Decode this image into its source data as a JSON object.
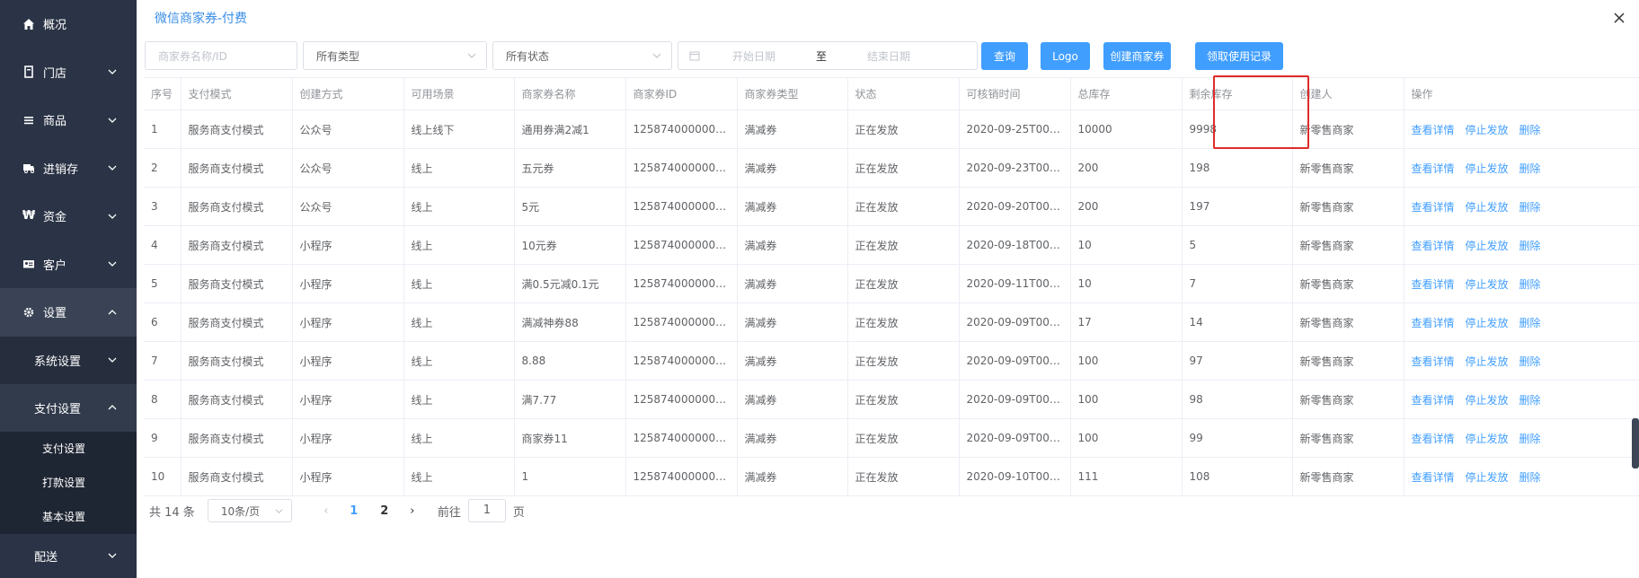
{
  "sidebar": {
    "items": [
      {
        "label": "概况",
        "icon": "home-icon"
      },
      {
        "label": "门店",
        "icon": "store-icon"
      },
      {
        "label": "商品",
        "icon": "list-icon"
      },
      {
        "label": "进销存",
        "icon": "truck-icon"
      },
      {
        "label": "资金",
        "icon": "won-icon"
      },
      {
        "label": "客户",
        "icon": "idcard-icon"
      },
      {
        "label": "设置",
        "icon": "gear-icon"
      }
    ],
    "settings_sub": {
      "system": "系统设置",
      "payment": "支付设置"
    },
    "payment_leaves": [
      "支付设置",
      "打款设置",
      "基本设置"
    ],
    "delivery": "配送"
  },
  "dialog": {
    "title": "微信商家券-付费"
  },
  "filters": {
    "name_placeholder": "商家券名称/ID",
    "type_value": "所有类型",
    "status_value": "所有状态",
    "start_placeholder": "开始日期",
    "range_sep": "至",
    "end_placeholder": "结束日期"
  },
  "buttons": {
    "query": "查询",
    "logo": "Logo",
    "create": "创建商家券",
    "records": "领取使用记录"
  },
  "table": {
    "headers": [
      "序号",
      "支付模式",
      "创建方式",
      "可用场景",
      "商家券名称",
      "商家券ID",
      "商家券类型",
      "状态",
      "可核销时间",
      "总库存",
      "剩余库存",
      "创建人",
      "操作"
    ],
    "actions": [
      "查看详情",
      "停止发放",
      "删除"
    ],
    "rows": [
      [
        "1",
        "服务商支付模式",
        "公众号",
        "线上线下",
        "通用券满2减1",
        "1258740000000...",
        "满减券",
        "正在发放",
        "2020-09-25T00:0...",
        "10000",
        "9998",
        "新零售商家"
      ],
      [
        "2",
        "服务商支付模式",
        "公众号",
        "线上",
        "五元券",
        "1258740000000...",
        "满减券",
        "正在发放",
        "2020-09-23T00:0...",
        "200",
        "198",
        "新零售商家"
      ],
      [
        "3",
        "服务商支付模式",
        "公众号",
        "线上",
        "5元",
        "1258740000000...",
        "满减券",
        "正在发放",
        "2020-09-20T00:0...",
        "200",
        "197",
        "新零售商家"
      ],
      [
        "4",
        "服务商支付模式",
        "小程序",
        "线上",
        "10元券",
        "1258740000000...",
        "满减券",
        "正在发放",
        "2020-09-18T00:0...",
        "10",
        "5",
        "新零售商家"
      ],
      [
        "5",
        "服务商支付模式",
        "小程序",
        "线上",
        "满0.5元减0.1元",
        "1258740000000...",
        "满减券",
        "正在发放",
        "2020-09-11T00:0...",
        "10",
        "7",
        "新零售商家"
      ],
      [
        "6",
        "服务商支付模式",
        "小程序",
        "线上",
        "满减神券88",
        "1258740000000...",
        "满减券",
        "正在发放",
        "2020-09-09T00:0...",
        "17",
        "14",
        "新零售商家"
      ],
      [
        "7",
        "服务商支付模式",
        "小程序",
        "线上",
        "8.88",
        "1258740000000...",
        "满减券",
        "正在发放",
        "2020-09-09T00:0...",
        "100",
        "97",
        "新零售商家"
      ],
      [
        "8",
        "服务商支付模式",
        "小程序",
        "线上",
        "满7.77",
        "1258740000000...",
        "满减券",
        "正在发放",
        "2020-09-09T00:0...",
        "100",
        "98",
        "新零售商家"
      ],
      [
        "9",
        "服务商支付模式",
        "小程序",
        "线上",
        "商家券11",
        "1258740000000...",
        "满减券",
        "正在发放",
        "2020-09-09T00:0...",
        "100",
        "99",
        "新零售商家"
      ],
      [
        "10",
        "服务商支付模式",
        "小程序",
        "线上",
        "1",
        "1258740000000...",
        "满减券",
        "正在发放",
        "2020-09-10T00:0...",
        "111",
        "108",
        "新零售商家"
      ]
    ]
  },
  "pagination": {
    "total": "共 14 条",
    "page_size": "10条/页",
    "pages": [
      "1",
      "2"
    ],
    "goto_label": "前往",
    "goto_value": "1",
    "page_suffix": "页"
  },
  "colors": {
    "sidebar_bg": "#2b3446",
    "primary": "#409eff",
    "highlight_border": "#e02b2b"
  }
}
